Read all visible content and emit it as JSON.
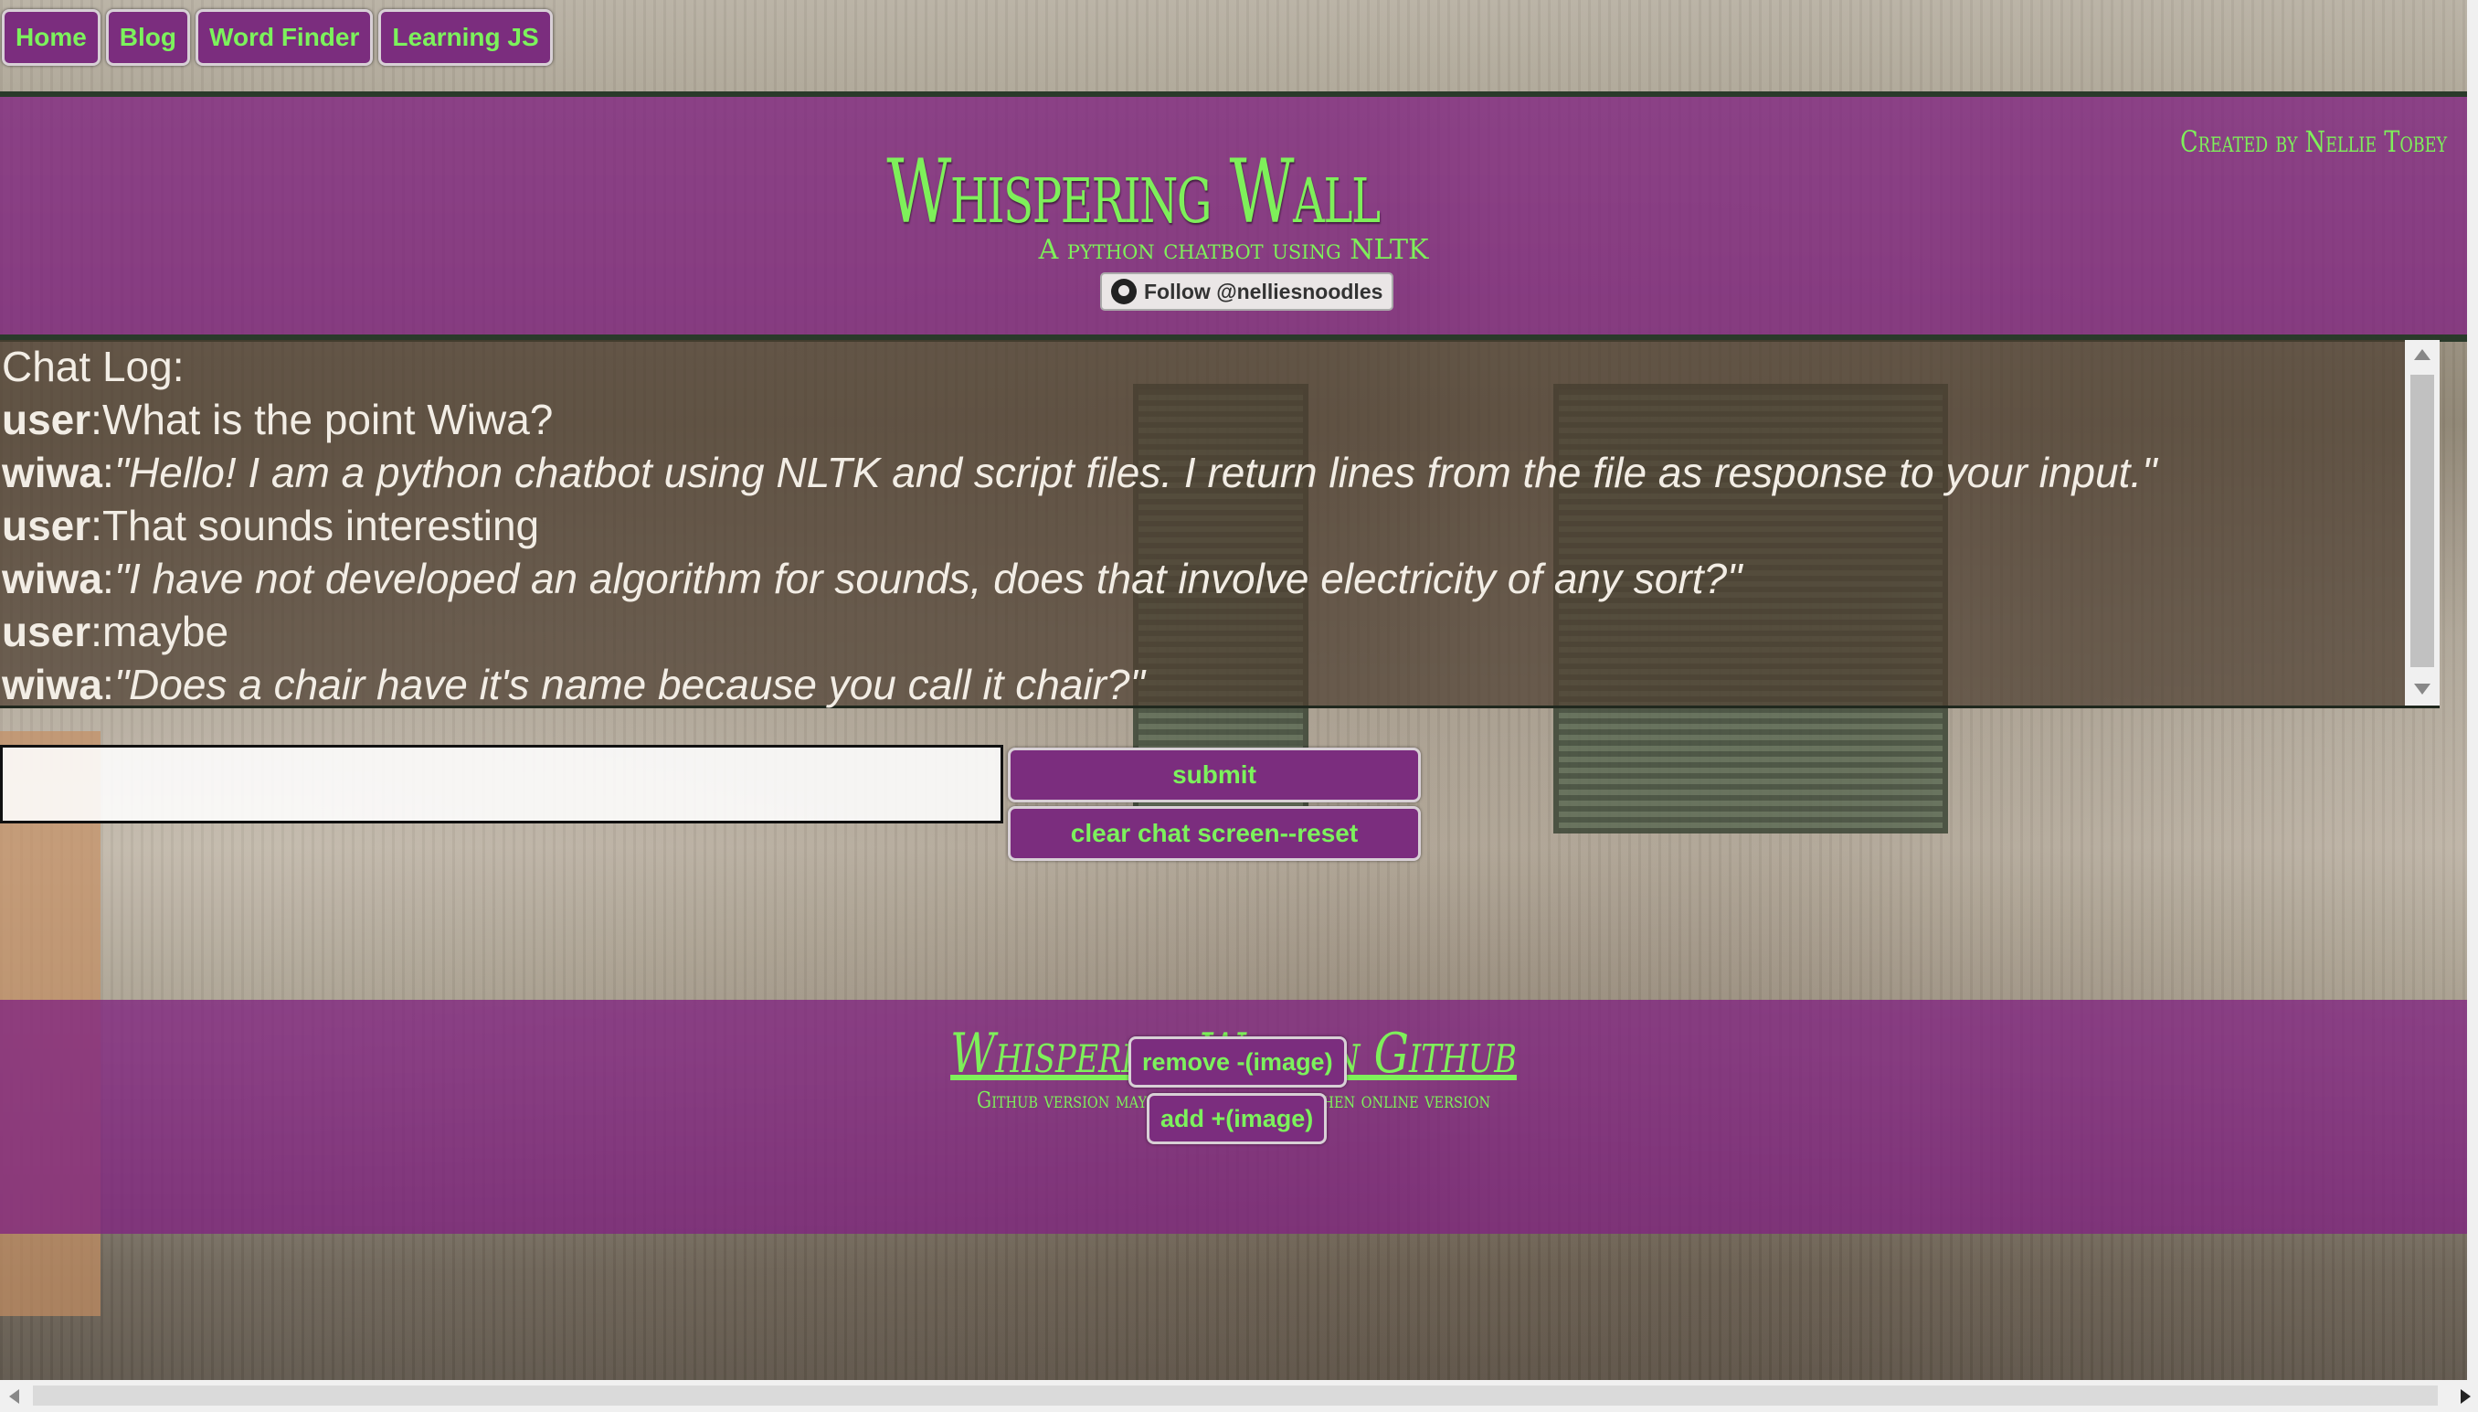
{
  "nav": {
    "items": [
      {
        "label": "Home"
      },
      {
        "label": "Blog"
      },
      {
        "label": "Word Finder"
      },
      {
        "label": "Learning JS"
      }
    ]
  },
  "header": {
    "title": "Whispering Wall",
    "subtitle": "A python chatbot using NLTK",
    "credit": "Created by Nellie Tobey",
    "follow_label": "Follow @nelliesnoodles"
  },
  "chat": {
    "heading": "Chat Log:",
    "messages": [
      {
        "speaker": "user",
        "sep": ":",
        "text": "What is the point Wiwa?"
      },
      {
        "speaker": "wiwa",
        "sep": ":",
        "text": "\"Hello! I am a python chatbot using NLTK and script files. I return lines from the file as response to your input.\""
      },
      {
        "speaker": "user",
        "sep": ":",
        "text": "That sounds interesting"
      },
      {
        "speaker": "wiwa",
        "sep": ":",
        "text": "\"I have not developed an algorithm for sounds, does that involve electricity of any sort?\""
      },
      {
        "speaker": "user",
        "sep": ":",
        "text": "maybe"
      },
      {
        "speaker": "wiwa",
        "sep": ":",
        "text": "\"Does a chair have it's name because you call it chair?\""
      }
    ]
  },
  "form": {
    "input_value": "",
    "submit_label": "submit",
    "reset_label": "clear chat screen--reset"
  },
  "footer": {
    "github_link": "Whispering Wall in Github",
    "note": "Github version may be more advanced then online version",
    "remove_image_label": "remove -(image)",
    "add_image_label": "add +(image)"
  },
  "colors": {
    "accent_purple": "#7b2d7e",
    "text_green": "#7cf25c"
  }
}
